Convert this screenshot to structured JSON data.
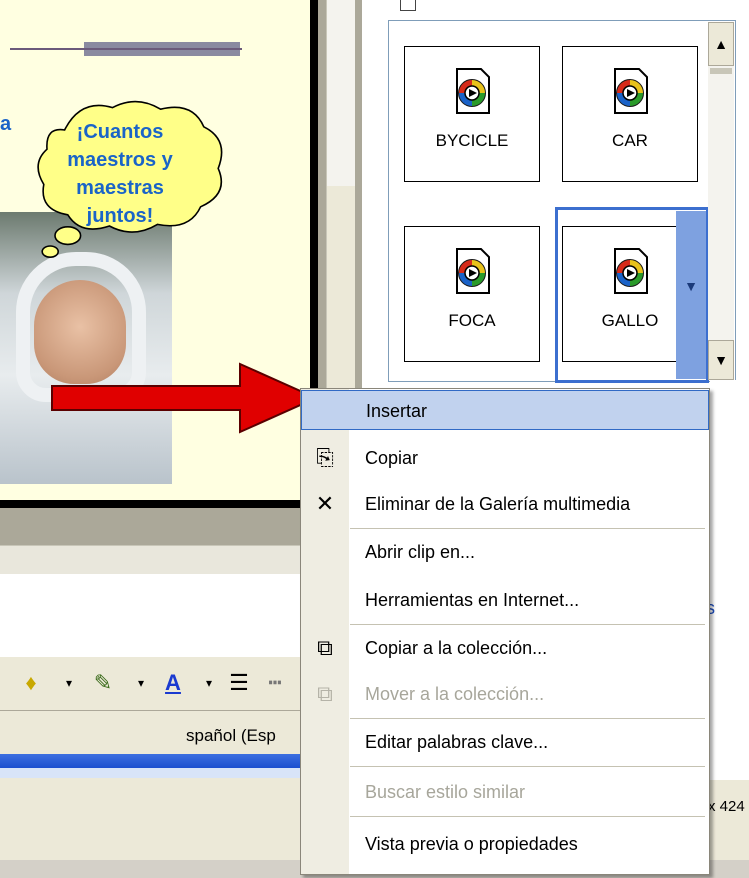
{
  "slide": {
    "bubble_lines": [
      "¡Cuantos",
      "maestros y",
      "maestras",
      "juntos!"
    ],
    "left_fragment": "a"
  },
  "status_bar": {
    "language": "spañol (Esp"
  },
  "gallery": {
    "clips": [
      {
        "label": "BYCICLE"
      },
      {
        "label": "CAR"
      },
      {
        "label": "FOCA"
      },
      {
        "label": "GALLO"
      }
    ]
  },
  "right_edge": {
    "link_fragment": "s",
    "status_fragment": "x 424"
  },
  "context_menu": {
    "items": [
      {
        "label": "Insertar",
        "icon": "none",
        "enabled": true,
        "highlighted": true
      },
      {
        "label": "Copiar",
        "icon": "copy-icon",
        "enabled": true
      },
      {
        "label": "Eliminar de la Galería multimedia",
        "icon": "delete-x-icon",
        "enabled": true
      },
      {
        "label": "Abrir clip en...",
        "icon": "none",
        "enabled": true
      },
      {
        "label": "Herramientas en Internet...",
        "icon": "none",
        "enabled": true
      },
      {
        "label": "Copiar a la colección...",
        "icon": "copy-to-collection-icon",
        "enabled": true
      },
      {
        "label": "Mover a la colección...",
        "icon": "move-to-collection-icon",
        "enabled": false
      },
      {
        "label": "Editar palabras clave...",
        "icon": "none",
        "enabled": true
      },
      {
        "label": "Buscar estilo similar",
        "icon": "none",
        "enabled": false
      },
      {
        "label": "Vista previa o propiedades",
        "icon": "none",
        "enabled": true
      }
    ]
  },
  "colors": {
    "highlight": "#c1d2ee",
    "highlight_border": "#316ac5",
    "bubble_text": "#1a64c8",
    "arrow": "#e00000"
  }
}
